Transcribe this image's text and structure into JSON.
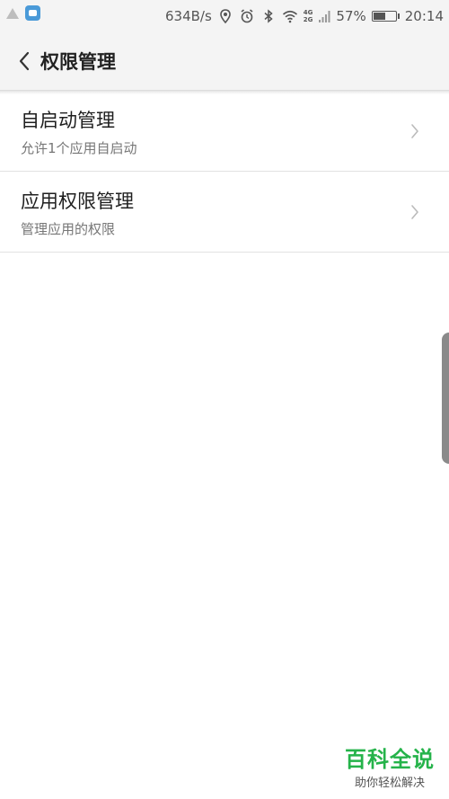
{
  "status_bar": {
    "network_speed": "634B/s",
    "net_4g": "4G",
    "net_2g": "2G",
    "battery_percent": "57%",
    "battery_level": 0.57,
    "time": "20:14",
    "icons": [
      "warning-icon",
      "app-notification-icon",
      "location-icon",
      "alarm-icon",
      "bluetooth-icon",
      "wifi-icon",
      "signal-icon",
      "battery-icon"
    ]
  },
  "header": {
    "title": "权限管理",
    "back_icon": "chevron-left-icon"
  },
  "list": {
    "items": [
      {
        "title": "自启动管理",
        "subtitle": "允许1个应用自启动",
        "icon": "chevron-right-icon"
      },
      {
        "title": "应用权限管理",
        "subtitle": "管理应用的权限",
        "icon": "chevron-right-icon"
      }
    ]
  },
  "watermark": {
    "main": "百科全说",
    "sub": "助你轻松解决"
  },
  "colors": {
    "background": "#ffffff",
    "bar_background": "#f4f4f4",
    "watermark_green": "#25b34a",
    "app_icon_blue": "#4a9ad8"
  }
}
